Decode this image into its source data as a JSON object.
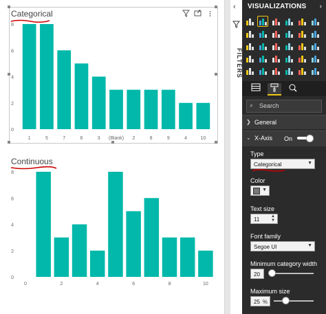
{
  "colors": {
    "bar": "#01b8aa",
    "panel_bg": "#2b2b2b",
    "accent": "#f2c811",
    "annotation": "#cc0000"
  },
  "filters_pane": {
    "label": "FILTERS",
    "icons": [
      "chevron-left-icon",
      "funnel-icon"
    ]
  },
  "visualizations_pane": {
    "title": "VISUALIZATIONS",
    "collapse_icon": "chevron-right-icon",
    "more_label": "···",
    "tab_icons": [
      "fields-icon",
      "format-paint-roller-icon",
      "analytics-magnifier-icon"
    ],
    "search_placeholder": "Search",
    "general_label": "General",
    "x_axis": {
      "label": "X-Axis",
      "toggle_label": "On",
      "type_label": "Type",
      "type_value": "Categorical",
      "color_label": "Color",
      "text_size_label": "Text size",
      "text_size_value": "11",
      "font_family_label": "Font family",
      "font_family_value": "Segoe UI",
      "min_category_width_label": "Minimum category width",
      "min_category_width_value": "20",
      "max_size_label": "Maximum size",
      "max_size_value": "25",
      "max_size_unit": "%"
    }
  },
  "visual_header_icons": [
    "filter-icon",
    "focus-mode-icon",
    "more-options-icon"
  ],
  "chart_data": [
    {
      "type": "bar",
      "title": "Categorical",
      "categories": [
        "1",
        "5",
        "7",
        "6",
        "3",
        "(Blank)",
        "2",
        "8",
        "9",
        "4",
        "10"
      ],
      "values": [
        8,
        8,
        6,
        5,
        4,
        3,
        3,
        3,
        3,
        2,
        2
      ],
      "ylim": [
        0,
        8
      ],
      "yticks": [
        "0",
        "2",
        "4",
        "6",
        "8"
      ],
      "grid": false
    },
    {
      "type": "bar",
      "title": "Continuous",
      "x": [
        1,
        2,
        3,
        4,
        5,
        6,
        7,
        8,
        9,
        10
      ],
      "values": [
        8,
        3,
        4,
        2,
        8,
        5,
        6,
        3,
        3,
        2
      ],
      "xlim": [
        0,
        10.5
      ],
      "xticks": [
        "0",
        "2",
        "4",
        "6",
        "8",
        "10"
      ],
      "ylim": [
        0,
        8
      ],
      "yticks": [
        "0",
        "2",
        "4",
        "6",
        "8"
      ],
      "grid": false
    }
  ]
}
